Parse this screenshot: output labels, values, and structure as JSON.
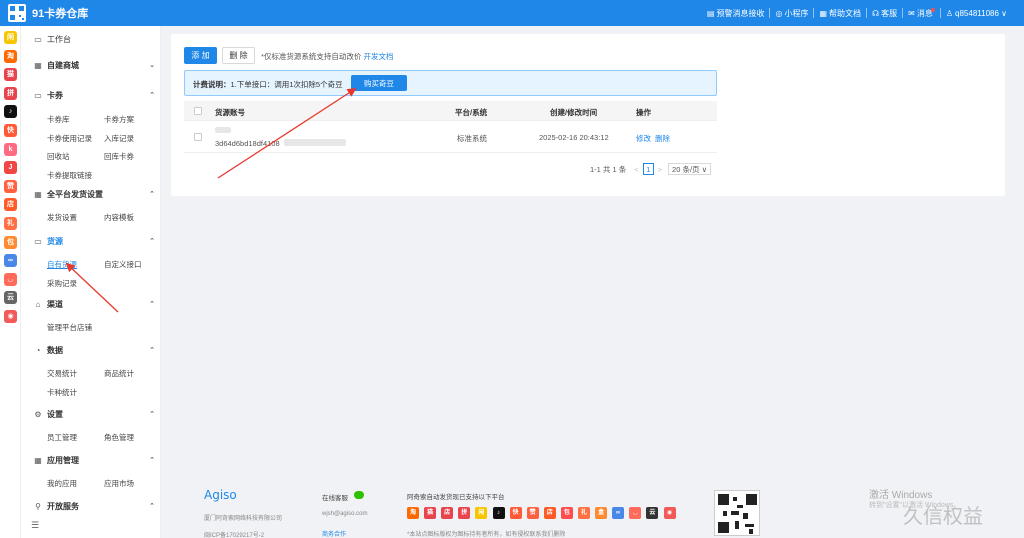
{
  "header": {
    "brand": "91卡券仓库",
    "nav": [
      {
        "icon": "clipboard-icon",
        "glyph": "▤",
        "label": "预警消息接收"
      },
      {
        "icon": "miniprogram-icon",
        "glyph": "◎",
        "label": "小程序"
      },
      {
        "icon": "doc-icon",
        "glyph": "▦",
        "label": "帮助文档"
      },
      {
        "icon": "headset-icon",
        "glyph": "☊",
        "label": "客服"
      },
      {
        "icon": "mail-icon",
        "glyph": "✉",
        "label": "消息"
      },
      {
        "icon": "user-icon",
        "glyph": "♙",
        "label": "q854811086 ∨"
      }
    ]
  },
  "sidebar": {
    "workbench": "工作台",
    "sections": [
      {
        "label": "自建商城",
        "icon": "▦",
        "name": "shop-icon",
        "expanded": false
      },
      {
        "label": "卡券",
        "icon": "▭",
        "name": "card-icon",
        "expanded": true
      },
      {
        "label": "全平台发货设置",
        "icon": "▦",
        "name": "grid-icon",
        "expanded": true
      },
      {
        "label": "货源",
        "icon": "▭",
        "name": "source-icon",
        "expanded": true
      },
      {
        "label": "渠道",
        "icon": "⌂",
        "name": "channel-icon",
        "expanded": true
      },
      {
        "label": "数据",
        "icon": "◔",
        "name": "data-icon",
        "expanded": true
      },
      {
        "label": "设置",
        "icon": "⚙",
        "name": "gear-icon",
        "expanded": true
      },
      {
        "label": "应用管理",
        "icon": "▦",
        "name": "apps-icon",
        "expanded": true
      },
      {
        "label": "开放服务",
        "icon": "⚲",
        "name": "open-service-icon",
        "expanded": true
      }
    ],
    "card_items": [
      "卡券库",
      "卡券方案",
      "卡券使用记录",
      "入库记录",
      "回收站",
      "回库卡券",
      "卡券提取链接"
    ],
    "ship_items": [
      "发货设置",
      "内容模板"
    ],
    "source_items": [
      "自有货源",
      "自定义接口",
      "采购记录"
    ],
    "channel_items": [
      "管理平台店铺"
    ],
    "data_items": [
      "交易统计",
      "商品统计",
      "卡种统计"
    ],
    "settings_items": [
      "员工管理",
      "角色管理"
    ],
    "app_items": [
      "我的应用",
      "应用市场"
    ],
    "collapse_glyph": "☰"
  },
  "toolbar": {
    "add_label": "添 加",
    "delete_label": "删 除",
    "note": "*仅标准货源系统支持自动改价",
    "dev_doc_link": "开发文档"
  },
  "notice": {
    "title": "计费说明：",
    "text": "1.下单接口：调用1次扣除5个奇豆",
    "buy_label": "购买奇豆"
  },
  "table": {
    "headers": [
      "货源账号",
      "平台/系统",
      "创建/修改时间",
      "操作"
    ],
    "rows": [
      {
        "account": "3d64d6bd18df4108",
        "platform": "标准系统",
        "time": "2025-02-16 20:43:12",
        "edit": "修改",
        "delete": "删除"
      }
    ]
  },
  "pagination": {
    "summary": "1-1 共 1 条",
    "prev": "<",
    "page": "1",
    "next": ">",
    "page_size": "20 条/页 ∨"
  },
  "footer": {
    "brand": "Agiso",
    "company": "厦门阿奇索网络科技有限公司",
    "icp": "闽ICP备17029217号-2",
    "online_service": "在线客服",
    "email": "wjsh@agiso.com",
    "business": "商务合作",
    "platforms_title": "阿奇索自动发货现已支持以下平台",
    "disclaimer": "*本站点图标版权为图标持有者所有，如有侵权联系我们删除",
    "windows_activate": "激活 Windows",
    "windows_hint": "转到\"设置\"以激活 Windows。",
    "overlay_watermark": "久信权益"
  },
  "strip_icons": [
    {
      "name": "platform-xianyu-icon",
      "glyph": "闲",
      "color": "#f7c600"
    },
    {
      "name": "platform-taobao-icon",
      "glyph": "淘",
      "color": "#ff6a00"
    },
    {
      "name": "platform-tmall-icon",
      "glyph": "猫",
      "color": "#e8444e"
    },
    {
      "name": "platform-pdd-icon",
      "glyph": "拼",
      "color": "#e8444e"
    },
    {
      "name": "platform-douyin-icon",
      "glyph": "♪",
      "color": "#111111"
    },
    {
      "name": "platform-kuaishou-icon",
      "glyph": "快",
      "color": "#ff5a35"
    },
    {
      "name": "platform-ks-icon",
      "glyph": "k",
      "color": "#ff6b81"
    },
    {
      "name": "platform-jd-icon",
      "glyph": "J",
      "color": "#f04646"
    },
    {
      "name": "platform-like-icon",
      "glyph": "赞",
      "color": "#ff6040"
    },
    {
      "name": "platform-store-icon",
      "glyph": "店",
      "color": "#ff5a28"
    },
    {
      "name": "platform-gift-icon",
      "glyph": "礼",
      "color": "#ff7043"
    },
    {
      "name": "platform-bag-icon",
      "glyph": "包",
      "color": "#ff8a30"
    },
    {
      "name": "platform-link-icon",
      "glyph": "∞",
      "color": "#4a88e8"
    },
    {
      "name": "platform-bot-icon",
      "glyph": "◡",
      "color": "#ff6b5a"
    },
    {
      "name": "platform-cloud-icon",
      "glyph": "云",
      "color": "#666666"
    },
    {
      "name": "platform-red-icon",
      "glyph": "◉",
      "color": "#f25a5a"
    }
  ],
  "footer_icons": [
    {
      "name": "footer-taobao-icon",
      "glyph": "淘",
      "color": "#ff6a00"
    },
    {
      "name": "footer-tmall-icon",
      "glyph": "猫",
      "color": "#e8444e"
    },
    {
      "name": "footer-shop-icon",
      "glyph": "店",
      "color": "#e8444e"
    },
    {
      "name": "footer-pdd-icon",
      "glyph": "拼",
      "color": "#e8444e"
    },
    {
      "name": "footer-xianyu-icon",
      "glyph": "闲",
      "color": "#f7c600"
    },
    {
      "name": "footer-douyin-icon",
      "glyph": "♪",
      "color": "#111111"
    },
    {
      "name": "footer-ks-icon",
      "glyph": "快",
      "color": "#ff5a35"
    },
    {
      "name": "footer-like-icon",
      "glyph": "赞",
      "color": "#ff6040"
    },
    {
      "name": "footer-store-icon",
      "glyph": "店",
      "color": "#ff5a28"
    },
    {
      "name": "footer-bag-icon",
      "glyph": "包",
      "color": "#ff4d4f"
    },
    {
      "name": "footer-gift-icon",
      "glyph": "礼",
      "color": "#ff7043"
    },
    {
      "name": "footer-box-icon",
      "glyph": "盒",
      "color": "#ff8a30"
    },
    {
      "name": "footer-link-icon",
      "glyph": "∞",
      "color": "#4a88e8"
    },
    {
      "name": "footer-bot-icon",
      "glyph": "◡",
      "color": "#ff6b5a"
    },
    {
      "name": "footer-cloud-icon",
      "glyph": "云",
      "color": "#333333"
    },
    {
      "name": "footer-red-icon",
      "glyph": "◉",
      "color": "#f25a5a"
    }
  ]
}
